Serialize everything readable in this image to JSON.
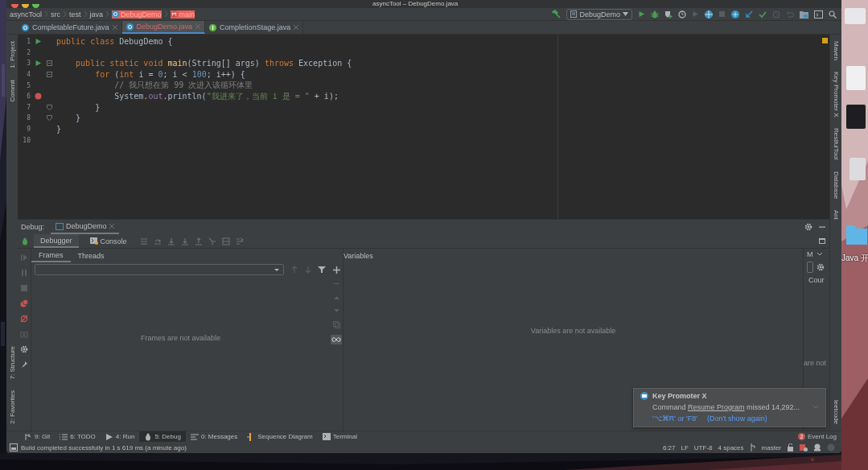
{
  "window": {
    "title": "asyncTool – DebugDemo.java"
  },
  "breadcrumbs": [
    {
      "label": "asyncTool",
      "kind": "project"
    },
    {
      "label": "src",
      "kind": "folder"
    },
    {
      "label": "test",
      "kind": "folder"
    },
    {
      "label": "java",
      "kind": "folder"
    },
    {
      "label": "DebugDemo",
      "kind": "class"
    },
    {
      "label": "main",
      "kind": "method"
    }
  ],
  "run_config": {
    "label": "DebugDemo"
  },
  "editor_tabs": [
    {
      "label": "CompletableFuture.java",
      "selected": false,
      "kind": "class"
    },
    {
      "label": "DebugDemo.java",
      "selected": true,
      "kind": "class"
    },
    {
      "label": "CompletionStage.java",
      "selected": false,
      "kind": "interface"
    }
  ],
  "left_tools": [
    {
      "label": "1: Project"
    },
    {
      "label": "Commit"
    }
  ],
  "left_tools_bottom": [
    {
      "label": "7: Structure"
    },
    {
      "label": "2: Favorites"
    }
  ],
  "right_tools": [
    {
      "label": "Maven"
    },
    {
      "label": "Key Promoter X"
    },
    {
      "label": "RestfulTool"
    },
    {
      "label": "Database"
    },
    {
      "label": "Ant"
    }
  ],
  "right_tools_bottom": [
    {
      "label": "leetcode"
    }
  ],
  "code_lines": [
    {
      "number": "1",
      "run_gutter": true,
      "breakpoint": false,
      "fold_start": false,
      "fold_end": false,
      "tokens": [
        {
          "kind": "keyword",
          "text": "public class "
        },
        {
          "kind": "plain",
          "text": "DebugDemo {"
        }
      ]
    },
    {
      "number": "2",
      "run_gutter": false,
      "breakpoint": false,
      "fold_start": false,
      "fold_end": false
    },
    {
      "number": "3",
      "run_gutter": true,
      "breakpoint": false,
      "fold_start": true,
      "fold_end": false,
      "tokens": [
        {
          "kind": "keyword",
          "text": "    public static void "
        },
        {
          "kind": "method",
          "text": "main"
        },
        {
          "kind": "plain",
          "text": "(String[] args) "
        },
        {
          "kind": "keyword",
          "text": "throws "
        },
        {
          "kind": "plain",
          "text": "Exception {"
        }
      ]
    },
    {
      "number": "4",
      "run_gutter": false,
      "breakpoint": false,
      "fold_start": true,
      "fold_end": false,
      "tokens": [
        {
          "kind": "keyword",
          "text": "        for "
        },
        {
          "kind": "plain",
          "text": "("
        },
        {
          "kind": "keyword",
          "text": "int "
        },
        {
          "kind": "plain",
          "text": "i = "
        },
        {
          "kind": "number",
          "text": "0"
        },
        {
          "kind": "plain",
          "text": "; i < "
        },
        {
          "kind": "number",
          "text": "100"
        },
        {
          "kind": "plain",
          "text": "; i++) {"
        }
      ]
    },
    {
      "number": "5",
      "run_gutter": false,
      "breakpoint": false,
      "fold_start": false,
      "fold_end": false,
      "tokens": [
        {
          "kind": "comment",
          "text": "            // 我只想在第 99 次进入该循环体里"
        }
      ]
    },
    {
      "number": "6",
      "run_gutter": false,
      "breakpoint": true,
      "fold_start": false,
      "fold_end": false,
      "tokens": [
        {
          "kind": "plain",
          "text": "            System."
        },
        {
          "kind": "field",
          "text": "out"
        },
        {
          "kind": "plain",
          "text": ".println("
        },
        {
          "kind": "string",
          "text": "\"我进来了，当前 i 是 = \""
        },
        {
          "kind": "plain",
          "text": " + i);"
        }
      ]
    },
    {
      "number": "7",
      "run_gutter": false,
      "breakpoint": false,
      "fold_start": false,
      "fold_end": true,
      "tokens": [
        {
          "kind": "plain",
          "text": "        }"
        }
      ]
    },
    {
      "number": "8",
      "run_gutter": false,
      "breakpoint": false,
      "fold_start": false,
      "fold_end": true,
      "tokens": [
        {
          "kind": "plain",
          "text": "    }"
        }
      ]
    },
    {
      "number": "9",
      "run_gutter": false,
      "breakpoint": false,
      "fold_start": false,
      "fold_end": false,
      "tokens": [
        {
          "kind": "plain",
          "text": "}"
        }
      ]
    },
    {
      "number": "10",
      "run_gutter": false,
      "breakpoint": false,
      "fold_start": false,
      "fold_end": false
    }
  ],
  "debug": {
    "title": "Debug:",
    "session_tab": "DebugDemo",
    "tabs": [
      {
        "label": "Debugger",
        "selected": true
      },
      {
        "label": "Console",
        "selected": false
      }
    ],
    "frame_tabs": [
      {
        "label": "Frames",
        "selected": true
      },
      {
        "label": "Threads",
        "selected": false
      }
    ],
    "frames_empty": "Frames are not available",
    "variables_title": "Variables",
    "variables_empty": "Variables are not available",
    "side_panel": {
      "tab": "M",
      "field": "Cour",
      "empty": "are not"
    }
  },
  "notification": {
    "title": "Key Promoter X",
    "message": {
      "before": "Command ",
      "link": "Resume Program",
      "after": " missed 14,292..."
    },
    "actions": [
      "'⌥⌘R' or 'F8'",
      "(Don't show again)"
    ]
  },
  "bottom_tabs": [
    {
      "label": "9: Git",
      "kind": "git",
      "selected": false
    },
    {
      "label": "6: TODO",
      "kind": "todo",
      "selected": false
    },
    {
      "label": "4: Run",
      "kind": "run",
      "selected": false
    },
    {
      "label": "5: Debug",
      "kind": "debug",
      "selected": true
    },
    {
      "label": "0: Messages",
      "kind": "messages",
      "selected": false
    },
    {
      "label": "Sequence Diagram",
      "kind": "sequence",
      "selected": false
    },
    {
      "label": "Terminal",
      "kind": "terminal",
      "selected": false
    }
  ],
  "event_log": {
    "label": "Event Log",
    "count": "2"
  },
  "status": {
    "message": "Build completed successfully in 1 s 619 ms (a minute ago)",
    "items": [
      "6:27",
      "LF",
      "UTF-8",
      "4 spaces",
      "master"
    ]
  },
  "desktop": {
    "labels": [
      "Java 开"
    ]
  }
}
